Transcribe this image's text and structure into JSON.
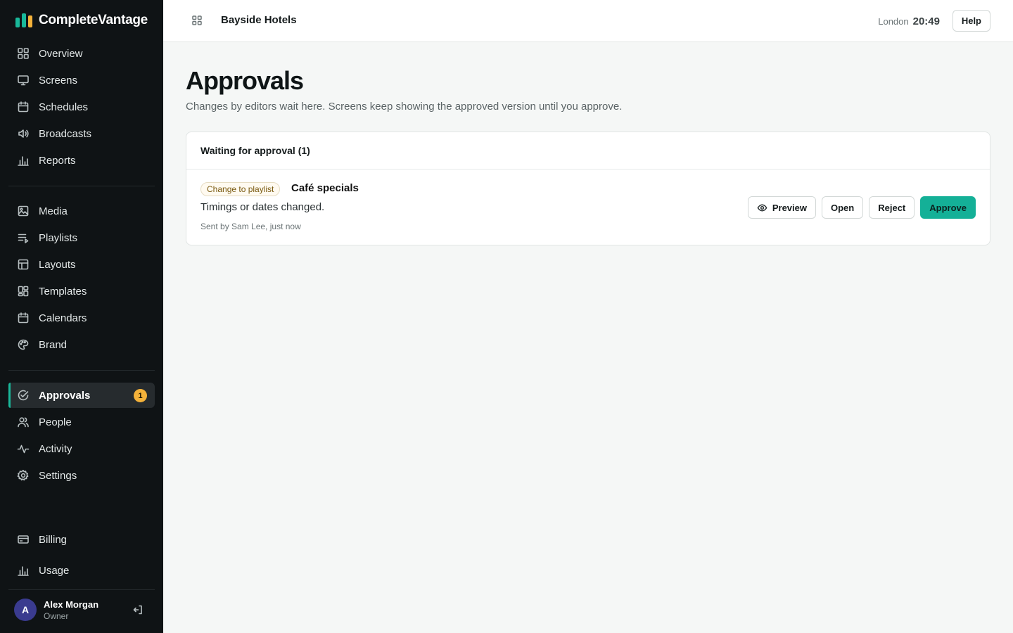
{
  "brand": {
    "name": "CompleteVantage"
  },
  "sidebar": {
    "group1": [
      {
        "label": "Overview",
        "icon": "grid-icon"
      },
      {
        "label": "Screens",
        "icon": "monitor-icon"
      },
      {
        "label": "Schedules",
        "icon": "calendar-icon"
      },
      {
        "label": "Broadcasts",
        "icon": "megaphone-icon"
      },
      {
        "label": "Reports",
        "icon": "bar-chart-icon"
      }
    ],
    "group2": [
      {
        "label": "Media",
        "icon": "image-icon"
      },
      {
        "label": "Playlists",
        "icon": "playlist-icon"
      },
      {
        "label": "Layouts",
        "icon": "layout-icon"
      },
      {
        "label": "Templates",
        "icon": "templates-icon"
      },
      {
        "label": "Calendars",
        "icon": "calendar-icon"
      },
      {
        "label": "Brand",
        "icon": "palette-icon"
      }
    ],
    "group3": [
      {
        "label": "Approvals",
        "icon": "check-circle-icon",
        "badge": "1",
        "active": true
      },
      {
        "label": "People",
        "icon": "people-icon"
      },
      {
        "label": "Activity",
        "icon": "activity-icon"
      },
      {
        "label": "Settings",
        "icon": "gear-icon"
      }
    ],
    "footer_nav": [
      {
        "label": "Billing",
        "icon": "card-icon"
      },
      {
        "label": "Usage",
        "icon": "bar-chart-icon"
      }
    ],
    "user": {
      "initial": "A",
      "name": "Alex Morgan",
      "role": "Owner"
    }
  },
  "topbar": {
    "org": "Bayside Hotels",
    "city": "London",
    "time": "20:49",
    "help_label": "Help"
  },
  "main": {
    "title": "Approvals",
    "subtitle": "Changes by editors wait here. Screens keep showing the approved version until you approve.",
    "card": {
      "heading": "Waiting for approval (1)",
      "items": [
        {
          "chip": "Change to playlist",
          "title": "Café specials",
          "description": "Timings or dates changed.",
          "meta": "Sent by Sam Lee, just now",
          "actions": {
            "preview": "Preview",
            "open": "Open",
            "reject": "Reject",
            "approve": "Approve"
          }
        }
      ]
    }
  },
  "colors": {
    "accent": "#14b097",
    "badge": "#f4b23a",
    "sidebar_bg": "#0f1315"
  }
}
